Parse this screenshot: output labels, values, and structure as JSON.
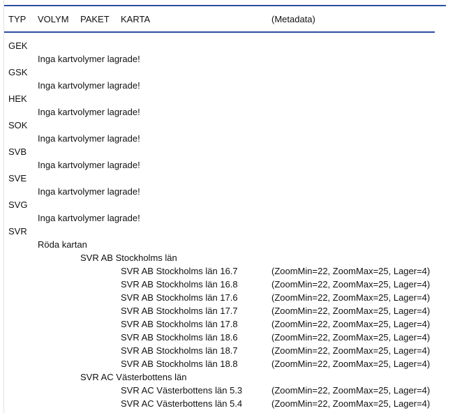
{
  "headers": {
    "typ": "TYP",
    "volym": "VOLYM",
    "paket": "PAKET",
    "karta": "KARTA",
    "metadata": "(Metadata)"
  },
  "rows": [
    {
      "level": "typ",
      "text": "GEK"
    },
    {
      "level": "volym",
      "text": "Inga kartvolymer lagrade!"
    },
    {
      "level": "typ",
      "text": "GSK"
    },
    {
      "level": "volym",
      "text": "Inga kartvolymer lagrade!"
    },
    {
      "level": "typ",
      "text": "HEK"
    },
    {
      "level": "volym",
      "text": "Inga kartvolymer lagrade!"
    },
    {
      "level": "typ",
      "text": "SOK"
    },
    {
      "level": "volym",
      "text": "Inga kartvolymer lagrade!"
    },
    {
      "level": "typ",
      "text": "SVB"
    },
    {
      "level": "volym",
      "text": "Inga kartvolymer lagrade!"
    },
    {
      "level": "typ",
      "text": "SVE"
    },
    {
      "level": "volym",
      "text": "Inga kartvolymer lagrade!"
    },
    {
      "level": "typ",
      "text": "SVG"
    },
    {
      "level": "volym",
      "text": "Inga kartvolymer lagrade!"
    },
    {
      "level": "typ",
      "text": "SVR"
    },
    {
      "level": "volym",
      "text": "Röda kartan"
    },
    {
      "level": "paket",
      "text": "SVR AB Stockholms län"
    },
    {
      "level": "karta",
      "text": "SVR AB Stockholms län 16.7",
      "meta": "(ZoomMin=22, ZoomMax=25, Lager=4)"
    },
    {
      "level": "karta",
      "text": "SVR AB Stockholms län 16.8",
      "meta": "(ZoomMin=22, ZoomMax=25, Lager=4)"
    },
    {
      "level": "karta",
      "text": "SVR AB Stockholms län 17.6",
      "meta": "(ZoomMin=22, ZoomMax=25, Lager=4)"
    },
    {
      "level": "karta",
      "text": "SVR AB Stockholms län 17.7",
      "meta": "(ZoomMin=22, ZoomMax=25, Lager=4)"
    },
    {
      "level": "karta",
      "text": "SVR AB Stockholms län 17.8",
      "meta": "(ZoomMin=22, ZoomMax=25, Lager=4)"
    },
    {
      "level": "karta",
      "text": "SVR AB Stockholms län 18.6",
      "meta": "(ZoomMin=22, ZoomMax=25, Lager=4)"
    },
    {
      "level": "karta",
      "text": "SVR AB Stockholms län 18.7",
      "meta": "(ZoomMin=22, ZoomMax=25, Lager=4)"
    },
    {
      "level": "karta",
      "text": "SVR AB Stockholms län 18.8",
      "meta": "(ZoomMin=22, ZoomMax=25, Lager=4)"
    },
    {
      "level": "paket",
      "text": "SVR AC Västerbottens län"
    },
    {
      "level": "karta",
      "text": "SVR AC Västerbottens län 5.3",
      "meta": "(ZoomMin=22, ZoomMax=25, Lager=4)"
    },
    {
      "level": "karta",
      "text": "SVR AC Västerbottens län 5.4",
      "meta": "(ZoomMin=22, ZoomMax=25, Lager=4)"
    }
  ]
}
